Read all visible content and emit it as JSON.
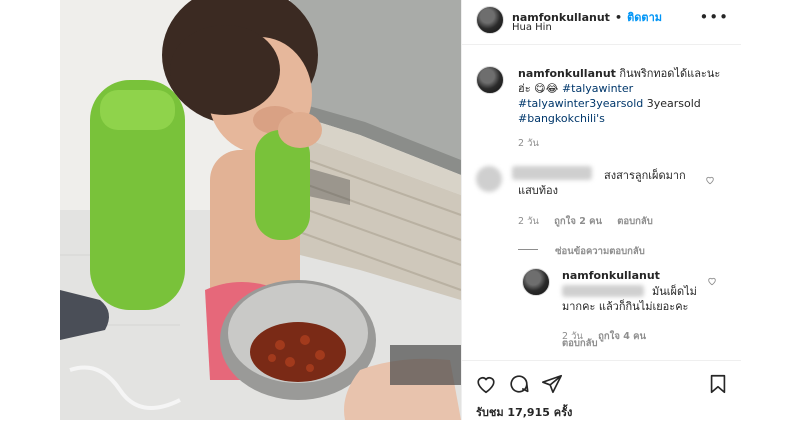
{
  "post": {
    "username": "namfonkullanut",
    "separator": "•",
    "follow_label": "ติดตาม",
    "location": "Hua Hin",
    "caption_text": "กินพริกทอดได้และนะฮ่ะ 😋😂",
    "caption_tags": [
      "#talyawinter",
      "#talyawinter3yearsold",
      "3yearsold",
      "#bangkokchili's"
    ],
    "caption_time": "2 วัน"
  },
  "comments": [
    {
      "text_line1": "สงสารลูกเผ็ดมาก",
      "text_line2": "แสบท้อง",
      "time": "2 วัน",
      "likes": "ถูกใจ 2 คน",
      "reply": "ตอบกลับ",
      "toggle_replies": "ซ่อนข้อความตอบกลับ"
    }
  ],
  "reply": {
    "username": "namfonkullanut",
    "text_line1": "มันเผ็ดไม่",
    "text_line2": "มากคะ แล้วก็กินไม่เยอะคะ",
    "time": "2 วัน",
    "likes": "ถูกใจ 4 คน",
    "reply": "ตอบกลับ"
  },
  "likes_count": "รับชม 17,915 ครั้ง",
  "icons": [
    "more-icon",
    "heart-icon",
    "comment-icon",
    "share-icon",
    "save-icon"
  ],
  "colors": {
    "follow": "#0095f6",
    "hashtag": "#00376b",
    "meta": "#8e8e8e",
    "float_green": "#79c23a"
  }
}
